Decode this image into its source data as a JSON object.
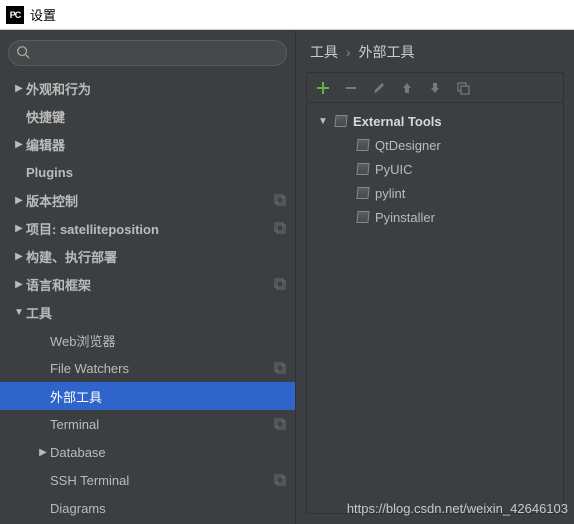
{
  "title": "设置",
  "search": {
    "value": "",
    "placeholder": ""
  },
  "sidebar": {
    "items": [
      {
        "label": "外观和行为",
        "arrow": "▶",
        "bold": true,
        "level": 0
      },
      {
        "label": "快捷键",
        "arrow": "",
        "bold": true,
        "level": 0
      },
      {
        "label": "编辑器",
        "arrow": "▶",
        "bold": true,
        "level": 0
      },
      {
        "label": "Plugins",
        "arrow": "",
        "bold": true,
        "level": 0
      },
      {
        "label": "版本控制",
        "arrow": "▶",
        "bold": true,
        "level": 0,
        "projIcon": true
      },
      {
        "label": "项目: satelliteposition",
        "arrow": "▶",
        "bold": true,
        "level": 0,
        "projIcon": true
      },
      {
        "label": "构建、执行部署",
        "arrow": "▶",
        "bold": true,
        "level": 0
      },
      {
        "label": "语言和框架",
        "arrow": "▶",
        "bold": true,
        "level": 0,
        "projIcon": true
      },
      {
        "label": "工具",
        "arrow": "▼",
        "bold": true,
        "level": 0
      },
      {
        "label": "Web浏览器",
        "arrow": "",
        "bold": false,
        "level": 1
      },
      {
        "label": "File Watchers",
        "arrow": "",
        "bold": false,
        "level": 1,
        "projIcon": true
      },
      {
        "label": "外部工具",
        "arrow": "",
        "bold": false,
        "level": 1,
        "selected": true
      },
      {
        "label": "Terminal",
        "arrow": "",
        "bold": false,
        "level": 1,
        "projIcon": true
      },
      {
        "label": "Database",
        "arrow": "▶",
        "bold": false,
        "level": 1
      },
      {
        "label": "SSH Terminal",
        "arrow": "",
        "bold": false,
        "level": 1,
        "projIcon": true
      },
      {
        "label": "Diagrams",
        "arrow": "",
        "bold": false,
        "level": 1
      }
    ]
  },
  "breadcrumb": {
    "part1": "工具",
    "part2": "外部工具"
  },
  "toolbar": {
    "add": "+",
    "remove": "−",
    "edit": "edit",
    "up": "up",
    "down": "down",
    "copy": "copy"
  },
  "tools": {
    "group": "External Tools",
    "items": [
      {
        "label": "QtDesigner"
      },
      {
        "label": "PyUIC"
      },
      {
        "label": "pylint"
      },
      {
        "label": "Pyinstaller"
      }
    ]
  },
  "colors": {
    "addGreen": "#62b543"
  },
  "watermark": "https://blog.csdn.net/weixin_42646103"
}
